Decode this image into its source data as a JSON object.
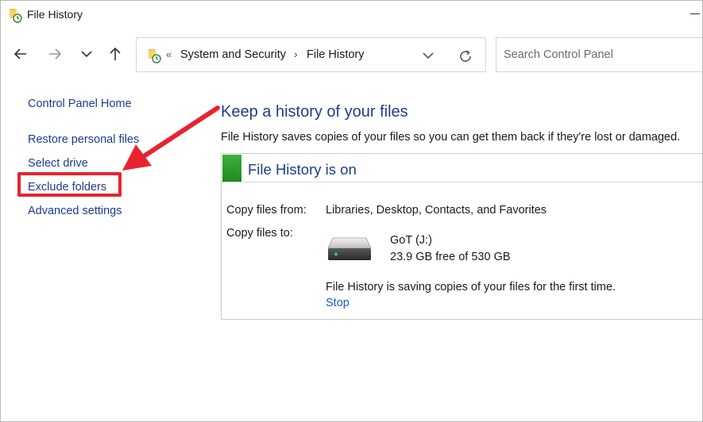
{
  "window": {
    "title": "File History"
  },
  "nav": {
    "back": "back-arrow-icon",
    "forward": "forward-arrow-icon",
    "recent": "chevron-down-icon",
    "up": "up-arrow-icon"
  },
  "address": {
    "overflow": "«",
    "crumbs": [
      {
        "label": "System and Security"
      },
      {
        "label": "File History"
      }
    ],
    "separator": "›"
  },
  "search": {
    "placeholder": "Search Control Panel",
    "value": ""
  },
  "sidebar": {
    "items": [
      {
        "label": "Control Panel Home"
      },
      {
        "label": "Restore personal files"
      },
      {
        "label": "Select drive"
      },
      {
        "label": "Exclude folders"
      },
      {
        "label": "Advanced settings"
      }
    ]
  },
  "main": {
    "title": "Keep a history of your files",
    "description": "File History saves copies of your files so you can get them back if they're lost or damaged.",
    "status_panel": {
      "title": "File History is on",
      "copy_from_label": "Copy files from:",
      "copy_from_value": "Libraries, Desktop, Contacts, and Favorites",
      "copy_to_label": "Copy files to:",
      "drive_name": "GoT (J:)",
      "drive_free": "23.9 GB free of 530 GB",
      "message": "File History is saving copies of your files for the first time.",
      "stop_label": "Stop"
    }
  },
  "colors": {
    "link": "#1b3d8f",
    "heading": "#1e3d8f",
    "status_green": "#2a9a2a",
    "annotation_red": "#e8232f"
  }
}
